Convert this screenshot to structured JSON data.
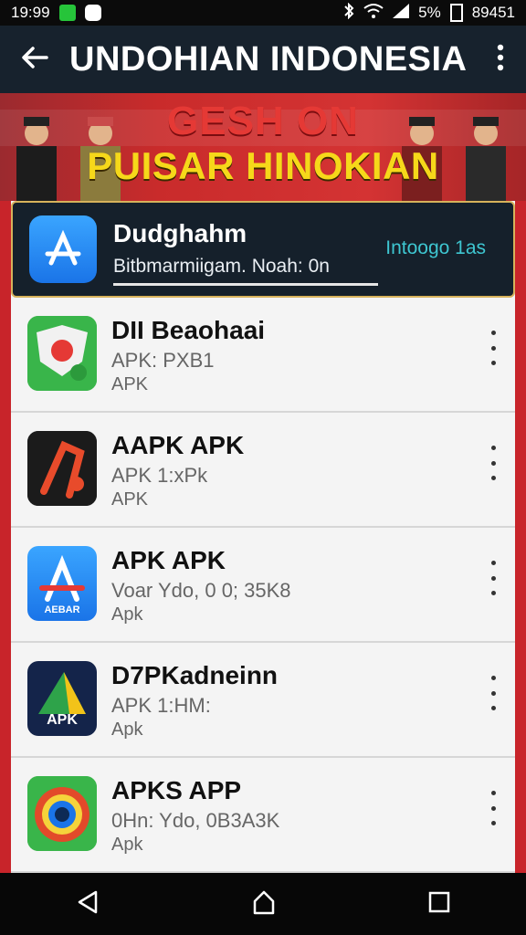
{
  "status_bar": {
    "time": "19:99",
    "battery": "5%",
    "extra": "89451"
  },
  "app_bar": {
    "title": "UNDOHIAN INDONESIA",
    "back_icon": "arrow-left-icon",
    "more_icon": "more-vert-icon"
  },
  "banner": {
    "line1": "GESH ON",
    "line2": "PUISAR HINOKIAN"
  },
  "featured": {
    "name": "Dudghahm",
    "subtitle": "Bitbmarmiigam. Noah: 0n",
    "status": "Intoogo 1as",
    "icon": "app-store-icon",
    "icon_color": "#2b8ef0"
  },
  "apps": [
    {
      "name": "DII Beaohaai",
      "meta": "APK: PXB1",
      "type": "APK",
      "icon": "map-pin-icon",
      "accent": "#39b54a"
    },
    {
      "name": "AAPK APK",
      "meta": "APK 1:xPk",
      "type": "APK",
      "icon": "crossbow-icon",
      "accent": "#e53935"
    },
    {
      "name": "APK APK",
      "meta": "Voar Ydo, 0 0; 35K8",
      "type": "Apk",
      "icon": "app-store-icon",
      "accent": "#1a74e8",
      "icon_label": "AEBAR"
    },
    {
      "name": "D7PKadneinn",
      "meta": "APK 1:HM:",
      "type": "Apk",
      "icon": "play-triangle-icon",
      "accent": "#14244a",
      "icon_label": "APK"
    },
    {
      "name": "APKS APP",
      "meta": "0Hn: Ydo, 0B3A3K",
      "type": "Apk",
      "icon": "camera-lens-icon",
      "accent": "#e24a2a"
    }
  ],
  "navbar": {
    "back": "back-triangle-icon",
    "home": "home-icon",
    "recents": "recents-square-icon"
  }
}
